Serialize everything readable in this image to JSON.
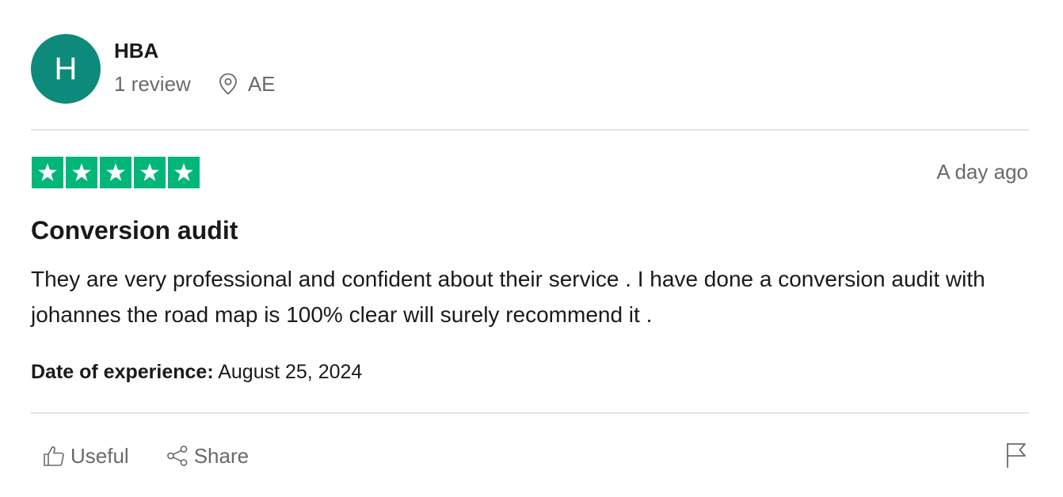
{
  "reviewer": {
    "initial": "H",
    "name": "HBA",
    "review_count": "1 review",
    "location": "AE",
    "avatar_color": "#0d8a79"
  },
  "review": {
    "rating_stars": 5,
    "rating_max": 5,
    "star_color": "#00b67a",
    "posted": "A day ago",
    "title": "Conversion audit",
    "body": "They are very professional and confident about their service . I have done a conversion audit with johannes the road map is 100% clear will surely recommend it .",
    "experience_label": "Date of experience:",
    "experience_date": "August 25, 2024"
  },
  "actions": {
    "useful_label": "Useful",
    "useful_icon": "thumbs-up-icon",
    "share_label": "Share",
    "share_icon": "share-icon",
    "flag_icon": "flag-icon"
  },
  "icons": {
    "location": "map-pin-icon",
    "star": "star-icon"
  }
}
